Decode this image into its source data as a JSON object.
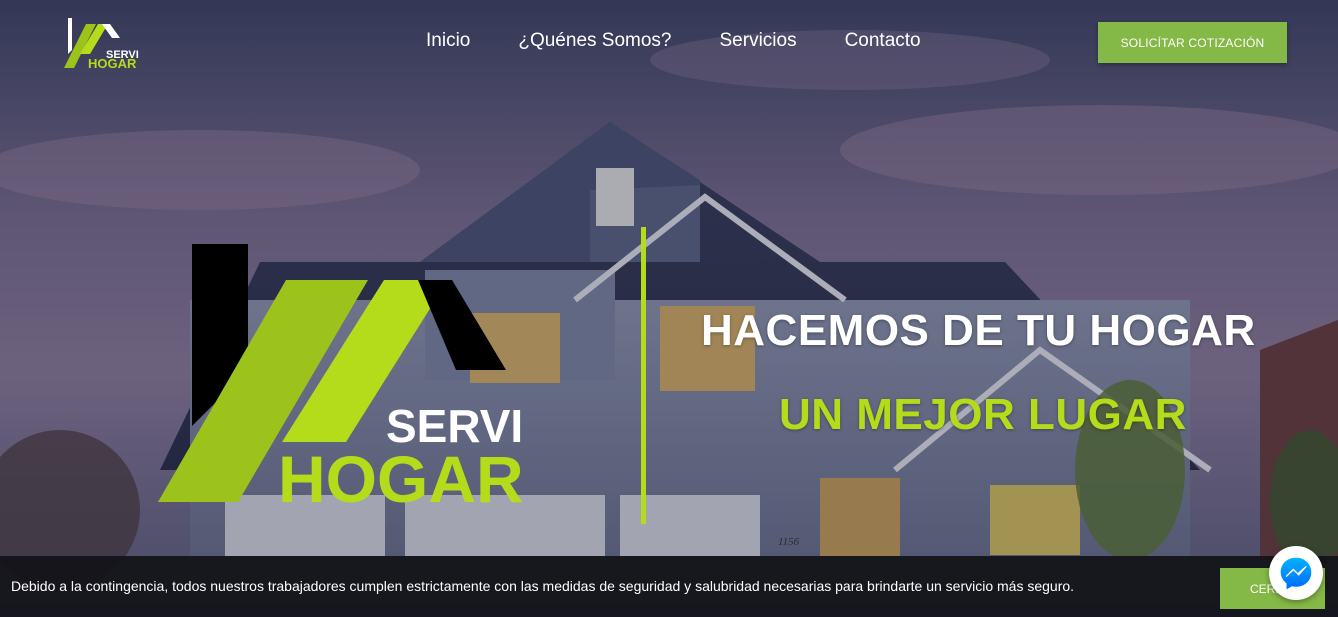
{
  "brand": {
    "logo_line1": "SERVI",
    "logo_line2": "HOGAR",
    "accent_color": "#b5dc1a",
    "button_color": "#84b847"
  },
  "nav": {
    "items": [
      {
        "label": "Inicio"
      },
      {
        "label": "¿Quénes Somos?"
      },
      {
        "label": "Servicios"
      },
      {
        "label": "Contacto"
      }
    ],
    "cta_label": "SOLICÍTAR COTIZACIÓN"
  },
  "hero": {
    "headline": "HACEMOS DE TU HOGAR",
    "subheadline": "UN MEJOR LUGAR",
    "house_number": "1156"
  },
  "notice": {
    "text": "Debido a la contingencia, todos nuestros trabajadores cumplen estrictamente con las medidas de seguridad y salubridad necesarias para brindarte un servicio más seguro.",
    "close_label": "CERRAR"
  },
  "chat": {
    "icon": "messenger-icon"
  }
}
